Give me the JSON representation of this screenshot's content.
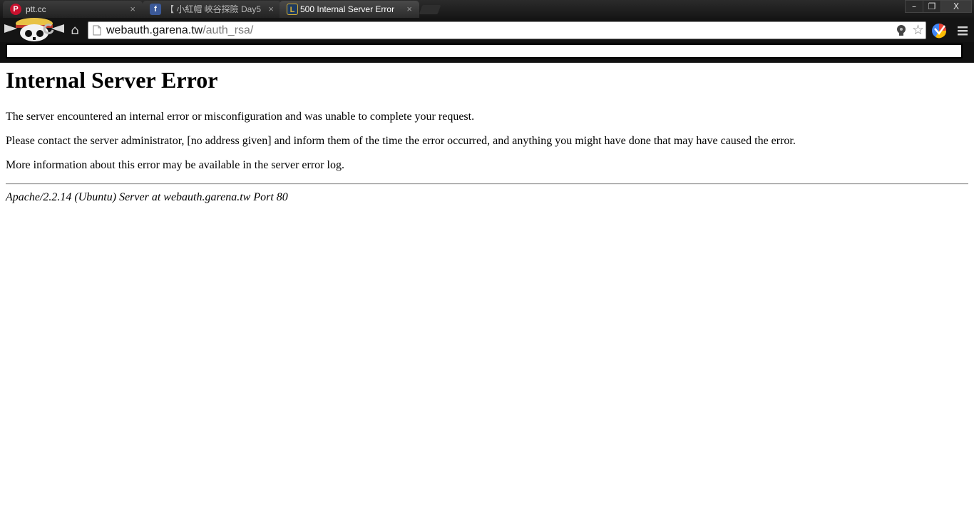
{
  "browser": {
    "tabs": [
      {
        "title": "ptt.cc",
        "favicon": "ptt-icon",
        "fav_letter": "P",
        "fav_color": "#c8102e",
        "close": "×"
      },
      {
        "title": "【 小紅帽 峽谷探險 Day5",
        "favicon": "facebook-icon",
        "fav_letter": "f",
        "fav_color": "#3b5998",
        "close": "×"
      },
      {
        "title": "500 Internal Server Error",
        "favicon": "league-icon",
        "fav_letter": "L",
        "fav_color": "#1e3a5f",
        "close": "×"
      }
    ],
    "window_controls": {
      "minimize": "–",
      "restore": "❐",
      "close": "X"
    },
    "home_glyph": "⌂",
    "star_glyph": "☆",
    "address": {
      "host": "webauth.garena.tw",
      "path": "/auth_rsa/"
    }
  },
  "page": {
    "heading": "Internal Server Error",
    "paragraphs": [
      "The server encountered an internal error or misconfiguration and was unable to complete your request.",
      "Please contact the server administrator, [no address given] and inform them of the time the error occurred, and anything you might have done that may have caused the error.",
      "More information about this error may be available in the server error log."
    ],
    "footer": "Apache/2.2.14 (Ubuntu) Server at webauth.garena.tw Port 80"
  }
}
